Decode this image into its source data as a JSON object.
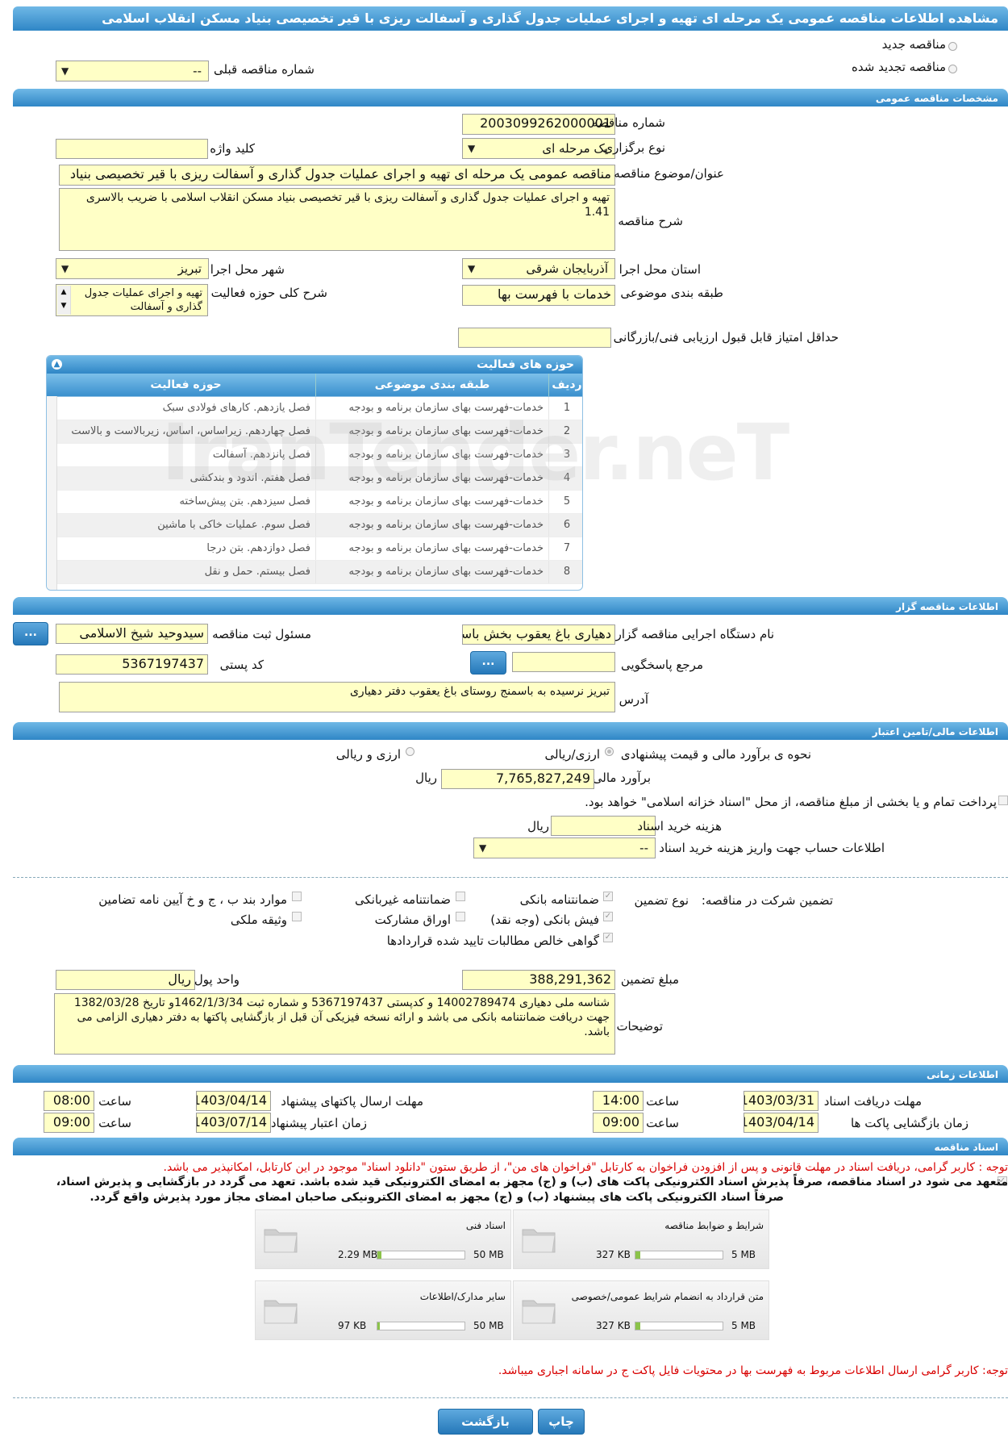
{
  "header": {
    "title": "مشاهده اطلاعات مناقصه عمومی یک مرحله ای تهیه و اجرای عملیات جدول گذاری و آسفالت ریزی با قیر تخصیصی بنیاد مسکن انقلاب اسلامی"
  },
  "top": {
    "new_tender": "مناقصه جدید",
    "renewed_tender": "مناقصه تجدید شده",
    "prev_tender_label": "شماره مناقصه قبلی",
    "prev_tender_value": "--"
  },
  "general": {
    "section_title": "مشخصات مناقصه عمومی",
    "tender_number_label": "شماره مناقصه",
    "tender_number": "2003099262000001",
    "hold_type_label": "نوع برگزاری",
    "hold_type": "یک مرحله ای",
    "keyword_label": "کلید واژه",
    "keyword": "",
    "subject_label": "عنوان/موضوع مناقصه",
    "subject": "مناقصه عمومی یک مرحله ای تهیه و اجرای عملیات جدول گذاری و آسفالت ریزی با قیر تخصیصی بنیاد",
    "desc_label": "شرح مناقصه",
    "desc": "تهیه و اجرای عملیات جدول گذاری و آسفالت ریزی با قیر تخصیصی بنیاد مسکن انقلاب اسلامی با ضریب بالاسری 1.41",
    "province_label": "استان محل اجرا",
    "province": "آذربایجان شرقی",
    "city_label": "شهر محل اجرا",
    "city": "تبریز",
    "category_label": "طبقه بندی موضوعی",
    "category": "خدمات با فهرست بها",
    "activity_desc_label": "شرح کلی حوزه فعالیت",
    "activity_desc": "تهیه و اجرای عملیات جدول گذاری و آسفالت",
    "min_score_label": "حداقل امتیاز قابل قبول ارزیابی فنی/بازرگانی",
    "min_score": ""
  },
  "activities": {
    "title": "حوزه های فعالیت",
    "headers": [
      "ردیف",
      "طبقه بندی موضوعی",
      "حوزه فعالیت"
    ],
    "rows": [
      {
        "n": "1",
        "cat": "خدمات-فهرست بهای سازمان برنامه و بودجه",
        "area": "فصل یازدهم. کارهای فولادی سبک"
      },
      {
        "n": "2",
        "cat": "خدمات-فهرست بهای سازمان برنامه و بودجه",
        "area": "فصل چهاردهم. زیراساس، اساس، زیربالاست و بالاست"
      },
      {
        "n": "3",
        "cat": "خدمات-فهرست بهای سازمان برنامه و بودجه",
        "area": "فصل پانزدهم. آسفالت"
      },
      {
        "n": "4",
        "cat": "خدمات-فهرست بهای سازمان برنامه و بودجه",
        "area": "فصل هفتم. اندود و بندکشی"
      },
      {
        "n": "5",
        "cat": "خدمات-فهرست بهای سازمان برنامه و بودجه",
        "area": "فصل سیزدهم. بتن پیش‌ساخته"
      },
      {
        "n": "6",
        "cat": "خدمات-فهرست بهای سازمان برنامه و بودجه",
        "area": "فصل سوم. عملیات خاکی با ماشین"
      },
      {
        "n": "7",
        "cat": "خدمات-فهرست بهای سازمان برنامه و بودجه",
        "area": "فصل دوازدهم. بتن درجا"
      },
      {
        "n": "8",
        "cat": "خدمات-فهرست بهای سازمان برنامه و بودجه",
        "area": "فصل بیستم. حمل و نقل"
      }
    ]
  },
  "organizer": {
    "section_title": "اطلاعات مناقصه گزار",
    "org_label": "نام دستگاه اجرایی مناقصه گزار",
    "org": "دهیاری باغ یعقوب بخش باسمنج",
    "registrar_label": "مسئول ثبت مناقصه",
    "registrar": "سیدوحید شیخ الاسلامی",
    "more_button": "...",
    "reference_label": "مرجع پاسخگویی",
    "reference": "",
    "postal_label": "کد پستی",
    "postal": "5367197437",
    "address_label": "آدرس",
    "address": "تبریز نرسیده به باسمنج روستای باغ یعقوب دفتر دهیاری"
  },
  "finance": {
    "section_title": "اطلاعات مالی/تامین اعتبار",
    "method_label": "نحوه ی برآورد مالی و قیمت پیشنهادی",
    "opt_currency": "ارزی/ریالی",
    "opt_currency_rial": "ارزی و ریالی",
    "estimate_label": "برآورد مالی",
    "estimate": "7,765,827,249",
    "rial": "ریال",
    "treasury_text": "پرداخت تمام و یا بخشی از مبلغ مناقصه، از محل \"اسناد خزانه اسلامی\" خواهد بود.",
    "doc_cost_label": "هزینه خرید اسناد",
    "doc_cost": "",
    "account_label": "اطلاعات حساب جهت واریز هزینه خرید اسناد",
    "account": "--"
  },
  "guarantee": {
    "participation_label": "تضمین شرکت در مناقصه:",
    "type_label": "نوع تضمین",
    "bank_guarantee": "ضمانتنامه بانکی",
    "non_bank_guarantee": "ضمانتنامه غیربانکی",
    "clauses": "موارد بند ب ، ج و خ آیین نامه تضامین",
    "bank_receipt": "فیش بانکی (وجه نقد)",
    "bonds": "اوراق مشارکت",
    "property": "وثیقه ملکی",
    "certificate": "گواهی خالص مطالبات تایید شده قراردادها",
    "amount_label": "مبلغ تضمین",
    "amount": "388,291,362",
    "currency_label": "واحد پول",
    "currency": "ریال",
    "notes_label": "توضیحات",
    "notes": "شناسه ملی دهیاری 14002789474 و کدپستی 5367197437 و شماره ثبت 1462/1/3/34و تاریخ 1382/03/28 جهت دریافت ضمانتنامه بانکی می باشد و ارائه نسخه فیزیکی آن قبل از بازگشایی پاکتها به دفتر دهیاری الزامی می باشد."
  },
  "timing": {
    "section_title": "اطلاعات زمانی",
    "doc_receive_label": "مهلت دریافت اسناد",
    "doc_receive_date": "1403/03/31",
    "doc_receive_time": "14:00",
    "send_deadline_label": "مهلت ارسال پاکتهای پیشنهاد",
    "send_deadline_date": "1403/04/14",
    "send_deadline_time": "08:00",
    "opening_label": "زمان بازگشایی پاکت ها",
    "opening_date": "1403/04/14",
    "opening_time": "09:00",
    "validity_label": "زمان اعتبار پیشنهاد",
    "validity_date": "1403/07/14",
    "validity_time": "09:00",
    "time_label": "ساعت"
  },
  "documents": {
    "section_title": "اسناد مناقصه",
    "notice": "توجه : کاربر گرامی، دریافت اسناد در مهلت قانونی و پس از افزودن فراخوان به کارتابل \"فراخوان های من\"، از طریق ستون \"دانلود اسناد\" موجود در این کارتابل، امکانپذیر می باشد.",
    "commit_line1": "متعهد می شود در اسناد مناقصه، صرفاً پذیرش اسناد الکترونیکی پاکت های (ب) و (ج) مجهز به امضای الکترونیکی قید شده باشد. تعهد می گردد در بازگشایی و پذیرش اسناد،",
    "commit_line2": "صرفاً اسناد الکترونیکی پاکت های پیشنهاد (ب) و (ج) مجهز به امضای الکترونیکی صاحبان امضای مجاز مورد پذیرش واقع گردد.",
    "files": [
      {
        "title": "شرایط و ضوابط مناقصه",
        "size": "327 KB",
        "max": "5 MB",
        "fill": 0.06
      },
      {
        "title": "اسناد فنی",
        "size": "2.29 MB",
        "max": "50 MB",
        "fill": 0.05
      },
      {
        "title": "متن قرارداد به انضمام شرایط عمومی/خصوصی",
        "size": "327 KB",
        "max": "5 MB",
        "fill": 0.06
      },
      {
        "title": "سایر مدارک/اطلاعات",
        "size": "97 KB",
        "max": "50 MB",
        "fill": 0.01
      }
    ],
    "bottom_notice": "توجه: کاربر گرامی ارسال اطلاعات مربوط به فهرست بها در محتویات فایل پاکت ج در سامانه اجباری میباشد."
  },
  "footer": {
    "back": "بازگشت",
    "print": "چاپ"
  },
  "watermark": "IranTender.neT",
  "colors": {
    "accent": "#2f86c6",
    "field_bg": "#ffffc6",
    "notice_red": "#d80000"
  }
}
